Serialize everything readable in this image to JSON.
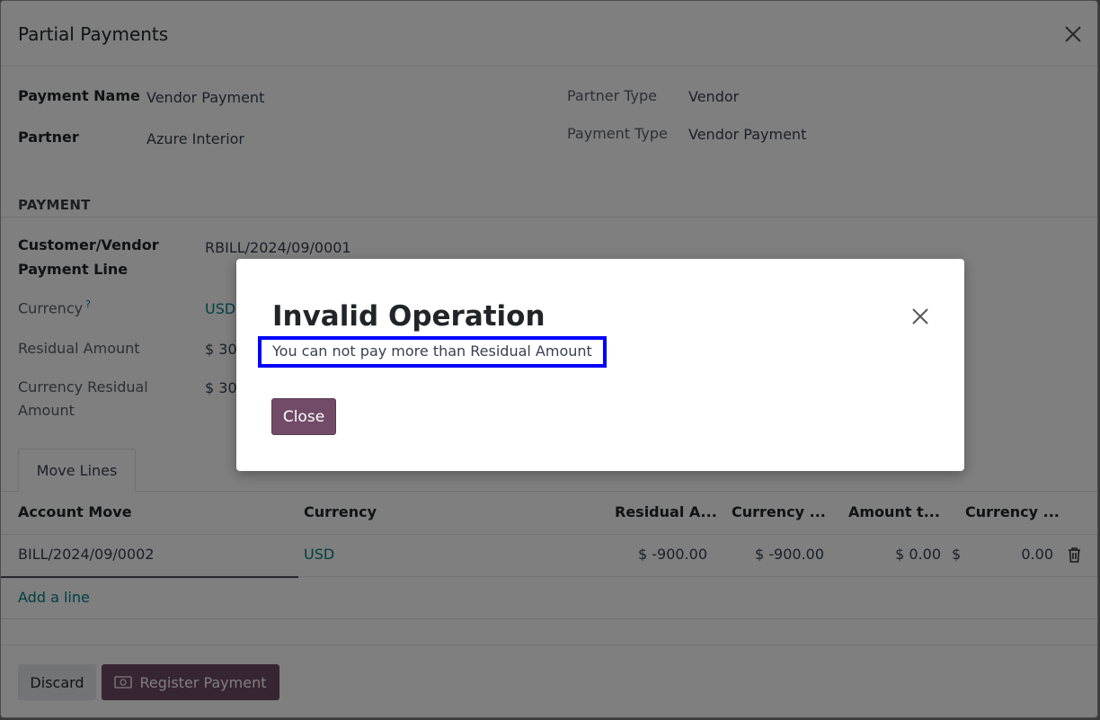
{
  "main_dialog": {
    "title": "Partial Payments",
    "fields_left": [
      {
        "label": "Payment Name",
        "value": "Vendor Payment"
      },
      {
        "label": "Partner",
        "value": "Azure Interior"
      }
    ],
    "fields_right": [
      {
        "label": "Partner Type",
        "value": "Vendor"
      },
      {
        "label": "Payment Type",
        "value": "Vendor Payment"
      }
    ],
    "payment_section": {
      "title": "PAYMENT",
      "line_label_1": "Customer/Vendor",
      "line_label_2": "Payment Line",
      "line_value": "RBILL/2024/09/0001",
      "currency_label": "Currency",
      "currency_help": "?",
      "currency_value": "USD",
      "residual_label": "Residual Amount",
      "residual_value": "$ 30.",
      "currency_residual_label_1": "Currency Residual",
      "currency_residual_label_2": "Amount",
      "currency_residual_value": "$ 30."
    },
    "tab_label": "Move Lines",
    "table": {
      "headers": [
        "Account Move",
        "Currency",
        "Residual A...",
        "Currency ...",
        "Amount t...",
        "Currency ..."
      ],
      "rows": [
        {
          "account_move": "BILL/2024/09/0002",
          "currency": "USD",
          "residual": "$ -900.00",
          "currency_residual": "$ -900.00",
          "amount": "$ 0.00",
          "currency_symbol": "$",
          "currency_amount": "0.00"
        }
      ],
      "add_line": "Add a line"
    },
    "footer": {
      "discard": "Discard",
      "register": "Register Payment"
    }
  },
  "error_modal": {
    "title": "Invalid Operation",
    "message": "You can not pay more than Residual Amount",
    "close_button": "Close"
  },
  "colors": {
    "primary": "#714b67",
    "link": "#017e84",
    "highlight": "#0000ff"
  }
}
